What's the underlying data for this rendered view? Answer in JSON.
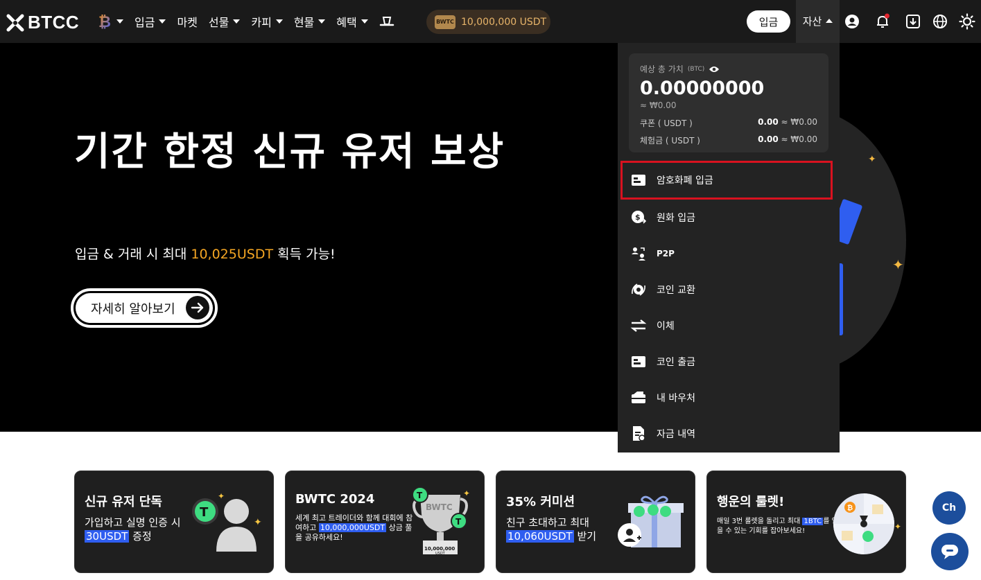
{
  "header": {
    "logo_text": "BTCC",
    "nav": [
      {
        "label": "",
        "icon": "bitcoin-logo-icon"
      },
      {
        "label": "입금"
      },
      {
        "label": "마켓"
      },
      {
        "label": "선물"
      },
      {
        "label": "카피"
      },
      {
        "label": "현물"
      },
      {
        "label": "혜택"
      }
    ],
    "bwtc_badge": "BWTC",
    "bwtc_pill": "10,000,000 USDT",
    "deposit_button": "입금",
    "assets_tab": "자산"
  },
  "hero": {
    "title": "기간 한정 신규 유저 보상",
    "subtitle_prefix": "입금 & 거래 시 최대 ",
    "subtitle_highlight": "10,025USDT",
    "subtitle_suffix": " 획득 가능!",
    "cta": "자세히 알아보기"
  },
  "assets_menu": {
    "estimated_label": "예상 총 가치",
    "estimated_unit": "(BTC)",
    "estimated_value": "0.00000000",
    "estimated_krw": "≈ ₩0.00",
    "coupon_label": "쿠폰 ( USDT )",
    "coupon_value": "0.00",
    "coupon_krw": "≈ ₩0.00",
    "trial_label": "체험금 ( USDT )",
    "trial_value": "0.00",
    "trial_krw": "≈ ₩0.00",
    "items": [
      {
        "label": "암호화폐 입금",
        "icon": "crypto-deposit-icon"
      },
      {
        "label": "원화 입금",
        "icon": "fiat-deposit-icon"
      },
      {
        "label": "P2P",
        "icon": "p2p-icon"
      },
      {
        "label": "코인 교환",
        "icon": "coin-exchange-icon"
      },
      {
        "label": "이체",
        "icon": "transfer-icon"
      },
      {
        "label": "코인 출금",
        "icon": "withdraw-icon"
      },
      {
        "label": "내 바우처",
        "icon": "voucher-icon"
      },
      {
        "label": "자금 내역",
        "icon": "fund-history-icon"
      }
    ]
  },
  "promo_cards": [
    {
      "title": "신규 유저 단독",
      "text_prefix": "가입하고 실명 인증 시",
      "highlight": "30USDT",
      "text_suffix": " 증정"
    },
    {
      "title": "BWTC 2024",
      "text_prefix": "세계 최고 트레이더와 함께 대회에 참여하고 ",
      "highlight": "10,000,000USDT",
      "text_suffix": " 상금 풀을 공유하세요!",
      "trophy_top": "BWTC",
      "trophy_plate": "10,000,000",
      "trophy_unit": "USDT"
    },
    {
      "title": "35% 커미션",
      "text_prefix": "친구 초대하고 최대",
      "highlight": "10,060USDT",
      "text_suffix": " 받기"
    },
    {
      "title": "행운의 룰렛!",
      "text_prefix": "매일 3번 룰렛을 돌리고 최대 ",
      "highlight": "1BTC",
      "text_suffix": "를 얻을 수 있는 기회를 잡아보세요!"
    }
  ],
  "chat": {
    "ch_label": "Ch"
  },
  "colors": {
    "accent_orange": "#f5a623",
    "highlight_red": "#d9121f",
    "brand_blue": "#2f5ef0"
  }
}
